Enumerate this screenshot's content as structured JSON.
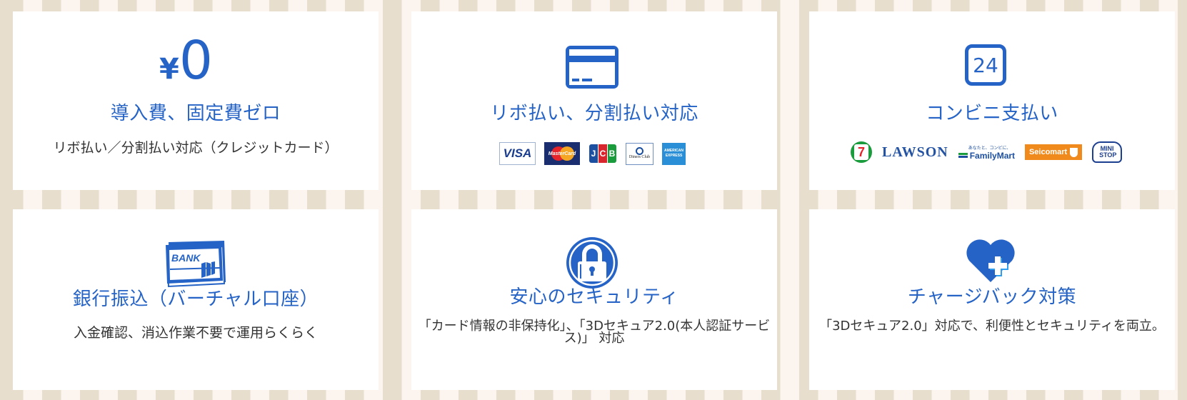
{
  "colors": {
    "accent": "#2563c6",
    "text": "#333333",
    "stripe_tan": "#e8dece",
    "stripe_cream": "#fcf4ee"
  },
  "cards": [
    {
      "icon": "yen-zero-icon",
      "icon_text": {
        "yen": "¥",
        "zero": "0"
      },
      "title": "導入費、固定費ゼロ",
      "description": "リボ払い／分割払い対応（クレジットカード）"
    },
    {
      "icon": "credit-card-icon",
      "title": "リボ払い、分割払い対応",
      "logos": [
        {
          "name": "VISA",
          "text": "VISA"
        },
        {
          "name": "MasterCard",
          "text": "MasterCard"
        },
        {
          "name": "JCB",
          "text": "JCB"
        },
        {
          "name": "Diners Club",
          "text": "Diners Club"
        },
        {
          "name": "American Express",
          "text": "AMERICAN EXPRESS"
        }
      ]
    },
    {
      "icon": "24-hours-icon",
      "icon_text": "24",
      "title": "コンビニ支払い",
      "logos": [
        {
          "name": "7-Eleven",
          "text": "7"
        },
        {
          "name": "LAWSON",
          "text": "LAWSON"
        },
        {
          "name": "FamilyMart",
          "text": "FamilyMart",
          "subtext": "あなたと、コンビに、"
        },
        {
          "name": "Seicomart",
          "text": "Seicomart"
        },
        {
          "name": "MINISTOP",
          "text": "MINI STOP"
        }
      ]
    },
    {
      "icon": "bank-book-icon",
      "icon_text": "BANK",
      "title": "銀行振込（バーチャル口座）",
      "description": "入金確認、消込作業不要で運用らくらく"
    },
    {
      "icon": "padlock-icon",
      "title": "安心のセキュリティ",
      "description": "「カード情報の非保持化」、「3Dセキュア2.0(本人認証サービス)」 対応"
    },
    {
      "icon": "heart-plus-icon",
      "title": "チャージバック対策",
      "description": "「3Dセキュア2.0」対応で、利便性とセキュリティを両立。"
    }
  ]
}
